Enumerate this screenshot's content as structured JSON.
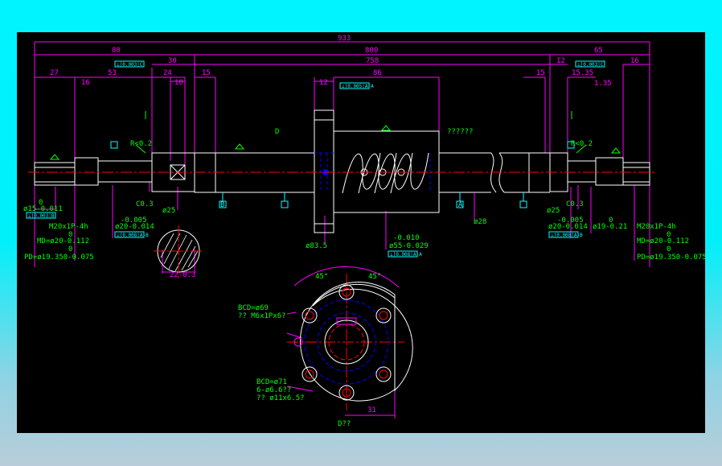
{
  "colors": {
    "background_outer": "#00f4ff",
    "drawing_bg": "#000000",
    "dimension": "#ff00ff",
    "annotation": "#00ff00",
    "outline": "#ffffff",
    "centerline": "#ff0000",
    "hidden": "#0000ff",
    "datum": "#00ffff"
  },
  "dims": {
    "overall": "933",
    "left_end": "80",
    "main": "800",
    "right_end": "65",
    "d30": "30",
    "d758": "758",
    "d12r": "12",
    "d16r": "16",
    "d27": "27",
    "d16l": "16",
    "d53": "53",
    "d24": "24",
    "d10": "10",
    "d15l": "15",
    "d12n": "12",
    "d86": "86",
    "d15r": "15",
    "r15_35": "15.35",
    "r1_35": "1.35",
    "c31": "31",
    "key_w": "22-0.3"
  },
  "annotations": {
    "r02_left": "R<0.2",
    "r02_right": "R<0.2",
    "c03_left": "C0.3",
    "c03_right": "C0.3",
    "d25_left": "ø25",
    "d25_right": "ø25",
    "d28": "ø28",
    "d83": "ø83.5",
    "d55_a": "-0.010",
    "d55_b": "ø55-0.029",
    "label_d": "D",
    "questions": "??????",
    "d15_a": "0",
    "d15_b": "ø15-0.011",
    "d20l_a": "-0.005",
    "d20l_b": "ø20-0.014",
    "d20r_a": "-0.005",
    "d20r_b": "ø20-0.014",
    "d19_a": "0",
    "d19_b": "ø19-0.21",
    "thread_l_1": "M20x1P-4h",
    "thread_l_2": "0",
    "thread_l_3": "MD=ø20-0.112",
    "thread_l_4": "0",
    "thread_l_5": "PD=ø19.350-0.075",
    "thread_r_1": "M20x1P-4h",
    "thread_r_2": "0",
    "thread_r_3": "MD=ø20-0.112",
    "thread_r_4": "0",
    "thread_r_5": "PD=ø19.350-0.075",
    "bcd69": "BCD=ø69",
    "m6": "?? M6x1Px6?",
    "bcd71": "BCD=ø71",
    "holes": "6-ø6.6??",
    "cbore": "?? ø11x6.5?",
    "angle1": "45°",
    "angle2": "45°",
    "view_label": "D??",
    "datum_a": "A",
    "datum_b": "B"
  },
  "frames": {
    "f1": "⊥|0.003|C",
    "f2": "⊥|0.005|A-A",
    "f3": "⊥|0.003|C",
    "f4": "⊥|0.003|B",
    "f5": "⊥|0.005|A-A",
    "f6": "⊥|0.008|A-B",
    "f7": "⊥|0.008|A-B",
    "f8": "⊥|0.008|A-A"
  }
}
